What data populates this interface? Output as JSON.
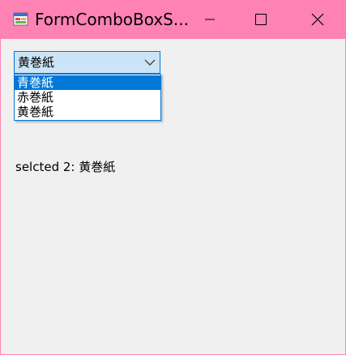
{
  "window": {
    "title": "FormComboBoxS...",
    "titlebar_color": "#ff82b4"
  },
  "titlebar": {
    "minimize_icon": "minimize-icon",
    "maximize_icon": "maximize-icon",
    "close_icon": "close-icon"
  },
  "combo": {
    "selected_value": "黄巻紙",
    "arrow_icon": "chevron-down-icon",
    "accent_color": "#0078d7"
  },
  "dropdown": {
    "items": [
      {
        "label": "青巻紙",
        "highlighted": true
      },
      {
        "label": "赤巻紙",
        "highlighted": false
      },
      {
        "label": "黄巻紙",
        "highlighted": false
      }
    ]
  },
  "status": {
    "text": "selcted 2: 黄巻紙"
  }
}
